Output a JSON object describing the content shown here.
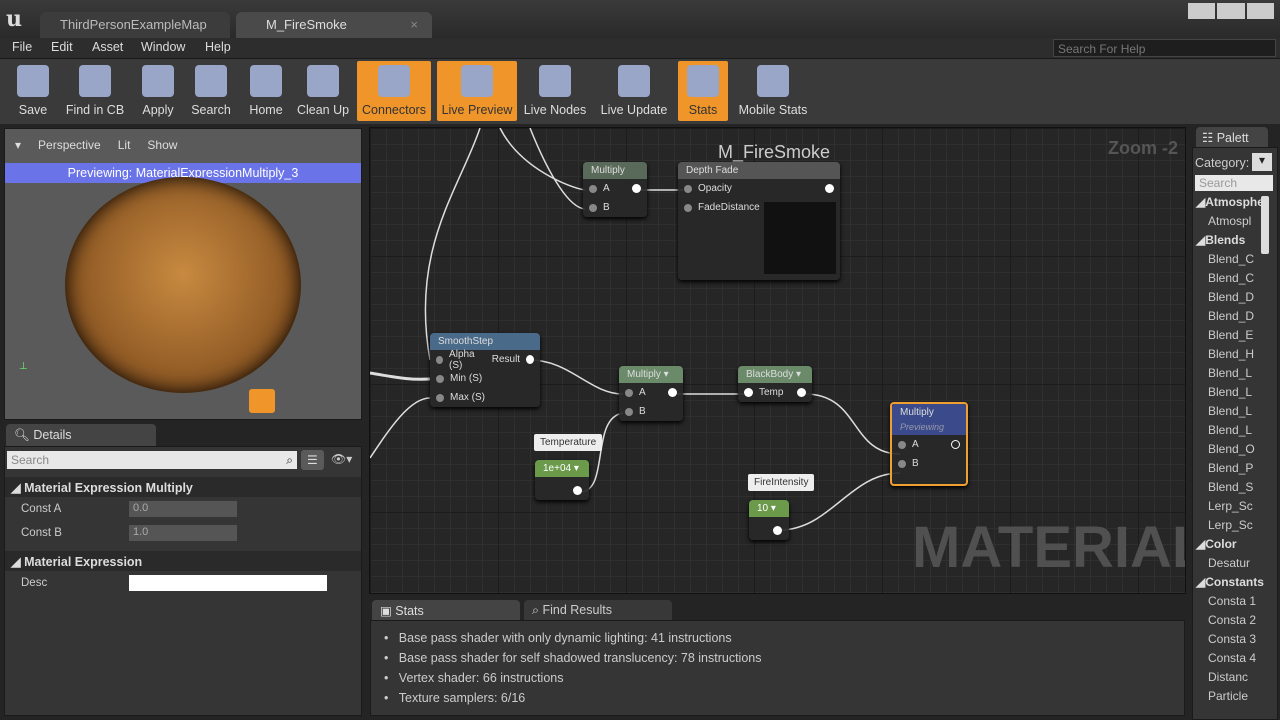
{
  "tabs": [
    "ThirdPersonExampleMap",
    "M_FireSmoke"
  ],
  "menu": [
    "File",
    "Edit",
    "Asset",
    "Window",
    "Help"
  ],
  "help_search": {
    "placeholder": "Search For Help"
  },
  "toolbar": [
    {
      "label": "Save",
      "active": false
    },
    {
      "label": "Find in CB",
      "active": false
    },
    {
      "label": "Apply",
      "active": false
    },
    {
      "label": "Search",
      "active": false
    },
    {
      "label": "Home",
      "active": false
    },
    {
      "label": "Clean Up",
      "active": false
    },
    {
      "label": "Connectors",
      "active": true
    },
    {
      "label": "Live Preview",
      "active": true
    },
    {
      "label": "Live Nodes",
      "active": false
    },
    {
      "label": "Live Update",
      "active": false
    },
    {
      "label": "Stats",
      "active": true
    },
    {
      "label": "Mobile Stats",
      "active": false
    }
  ],
  "viewport": {
    "perspective": "Perspective",
    "lit": "Lit",
    "show": "Show",
    "previewing": "Previewing: MaterialExpressionMultiply_3"
  },
  "details": {
    "tab": "Details",
    "search_placeholder": "Search",
    "section1": "Material Expression Multiply",
    "const_a_label": "Const A",
    "const_a": "0.0",
    "const_b_label": "Const B",
    "const_b": "1.0",
    "section2": "Material Expression",
    "desc_label": "Desc",
    "desc": ""
  },
  "graph": {
    "title": "M_FireSmoke",
    "zoom": "Zoom -2",
    "watermark": "MATERIAL",
    "nodes": {
      "multiply_top": {
        "title": "Multiply",
        "a": "A",
        "b": "B"
      },
      "depth_fade": {
        "title": "Depth Fade",
        "opacity": "Opacity",
        "fade": "FadeDistance"
      },
      "smoothstep": {
        "title": "SmoothStep",
        "alpha": "Alpha (S)",
        "result": "Result",
        "min": "Min (S)",
        "max": "Max (S)"
      },
      "multiply_mid": {
        "title": "Multiply",
        "a": "A",
        "b": "B"
      },
      "blackbody": {
        "title": "BlackBody",
        "temp": "Temp"
      },
      "temperature": {
        "comment": "Temperature",
        "value": "1e+04"
      },
      "fireintensity": {
        "comment": "FireIntensity",
        "value": "10"
      },
      "multiply_sel": {
        "title": "Multiply",
        "sub": "Previewing",
        "a": "A",
        "b": "B"
      }
    }
  },
  "bottom": {
    "tabs": [
      "Stats",
      "Find Results"
    ],
    "stats": [
      "Base pass shader with only dynamic lighting: 41 instructions",
      "Base pass shader for self shadowed translucency: 78 instructions",
      "Vertex shader: 66 instructions",
      "Texture samplers: 6/16"
    ]
  },
  "palette": {
    "tab": "Palett",
    "category": "Category:",
    "search_placeholder": "Search",
    "groups": [
      {
        "name": "Atmosphe",
        "items": [
          "Atmospl"
        ]
      },
      {
        "name": "Blends",
        "items": [
          "Blend_C",
          "Blend_C",
          "Blend_D",
          "Blend_D",
          "Blend_E",
          "Blend_H",
          "Blend_L",
          "Blend_L",
          "Blend_L",
          "Blend_L",
          "Blend_O",
          "Blend_P",
          "Blend_S",
          "Lerp_Sc",
          "Lerp_Sc"
        ]
      },
      {
        "name": "Color",
        "items": [
          "Desatur"
        ]
      },
      {
        "name": "Constants",
        "items": [
          "Consta 1",
          "Consta 2",
          "Consta 3",
          "Consta 4",
          "Distanc",
          "Particle"
        ]
      }
    ]
  }
}
